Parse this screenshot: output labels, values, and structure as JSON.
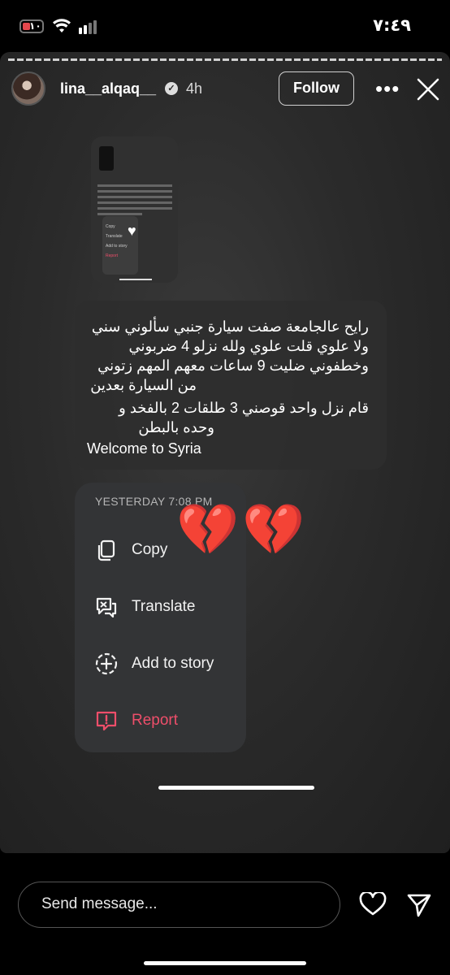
{
  "status_bar": {
    "time": "٧:٤٩",
    "battery": "١٠",
    "icons": [
      "battery-icon",
      "wifi-icon",
      "signal-icon"
    ]
  },
  "story": {
    "username": "lina__alqaq__",
    "age": "4h",
    "follow_label": "Follow",
    "more_icon": "more-dots-icon",
    "close_icon": "close-icon",
    "screenshot_preview": {
      "menu_items": [
        "Copy",
        "Translate",
        "Add to story",
        "Report"
      ]
    },
    "message_lines": [
      "رايح عالجامعة صفت سيارة جنبي سألوني سني",
      "ولا علوي قلت علوي ولله نزلو 4 ضربوني",
      "وخطفوني ضليت 9 ساعات معهم المهم زتوني",
      "من السيارة بعدين",
      "قام نزل واحد قوصني 3 طلقات 2 بالفخد و",
      "وحده بالبطن",
      "Welcome to Syria"
    ],
    "menu": {
      "timestamp": "YESTERDAY 7:08 PM",
      "items": [
        {
          "label": "Copy",
          "icon": "copy-icon"
        },
        {
          "label": "Translate",
          "icon": "translate-icon"
        },
        {
          "label": "Add to story",
          "icon": "add-to-story-icon"
        },
        {
          "label": "Report",
          "icon": "report-icon",
          "color": "#ee4e6a"
        }
      ]
    },
    "stickers": [
      "💔",
      "💔"
    ]
  },
  "reply_bar": {
    "placeholder": "Send message...",
    "like_icon": "heart-icon",
    "share_icon": "send-icon"
  }
}
